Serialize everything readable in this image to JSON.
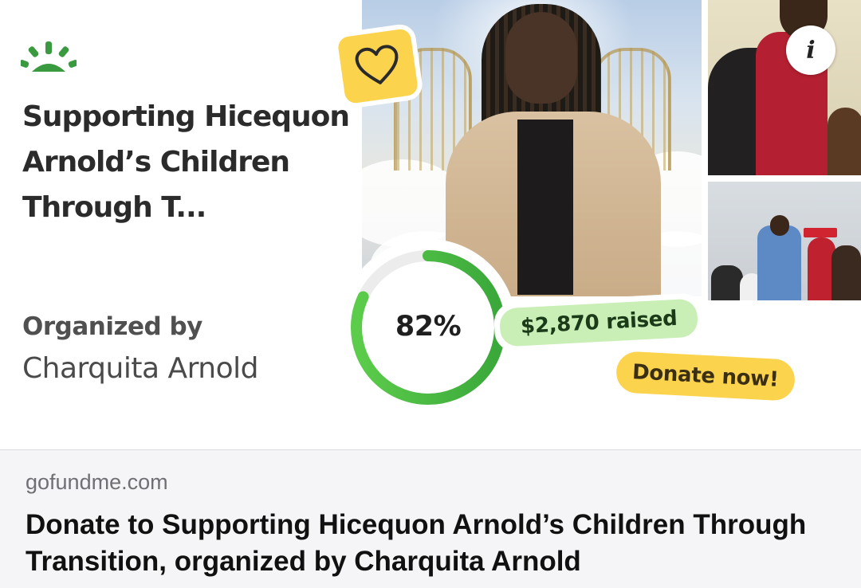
{
  "card": {
    "title": "Supporting Hicequon Arnold’s Children Through T...",
    "organized_by_label": "Organized by",
    "organizer_name": "Charquita Arnold",
    "progress_percent_text": "82%",
    "progress_fraction": 0.82,
    "raised_text": "$2,870 raised",
    "donate_label": "Donate now!",
    "icons": {
      "logo": "gofundme-sunrise-icon",
      "heart": "heart-icon",
      "info": "info-icon"
    },
    "info_glyph": "i",
    "colors": {
      "brand_green": "#3a9a3f",
      "ring_green": "#4cbb3f",
      "raised_bg": "#c9efb6",
      "donate_bg": "#fcd34d",
      "heart_bg": "#fcd34d"
    }
  },
  "link_preview": {
    "domain": "gofundme.com",
    "title": "Donate to Supporting Hicequon Arnold’s Children Through Transition, organized by Charquita Arnold"
  }
}
